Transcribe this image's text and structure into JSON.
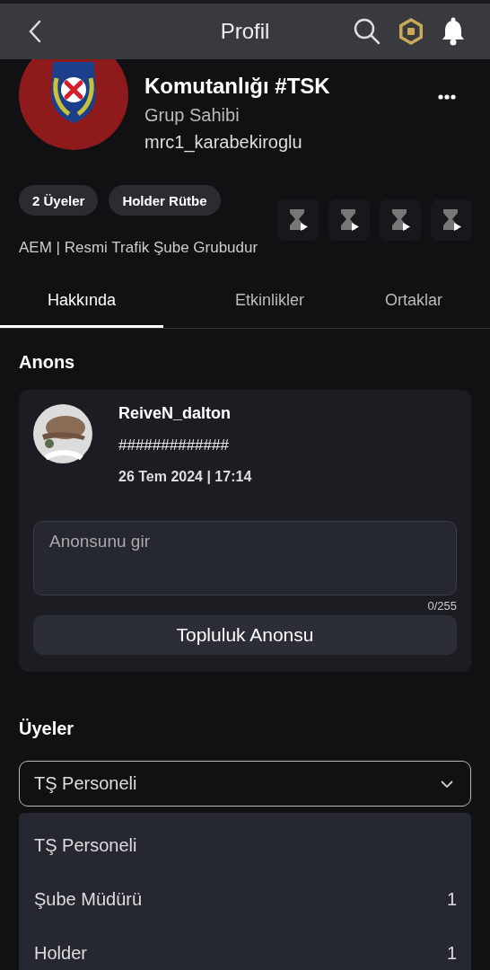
{
  "header": {
    "title": "Profil"
  },
  "group": {
    "name_line_2": "Komutanlığı #TSK",
    "role": "Grup Sahibi",
    "owner": "mrc1_karabekiroglu",
    "chips": [
      "2 Üyeler",
      "Holder Rütbe"
    ],
    "description": "AEM | Resmi Trafik Şube Grubudur"
  },
  "tabs": [
    {
      "label": "Hakkında",
      "selected": true
    },
    {
      "label": "Etkinlikler",
      "selected": false
    },
    {
      "label": "Ortaklar",
      "selected": false
    }
  ],
  "announcements": {
    "title": "Anons",
    "post": {
      "author": "ReiveN_dalton",
      "text": "#############",
      "date": "26 Tem 2024 | 17:14"
    },
    "input": {
      "placeholder": "Anonsunu gir",
      "counter": "0/255"
    },
    "button": "Topluluk Anonsu"
  },
  "members": {
    "title": "Üyeler",
    "select": {
      "value": "TŞ Personeli"
    },
    "options": [
      {
        "label": "TŞ Personeli"
      },
      {
        "label": "Şube Müdürü",
        "count": "1"
      },
      {
        "label": "Holder",
        "count": "1"
      }
    ]
  }
}
